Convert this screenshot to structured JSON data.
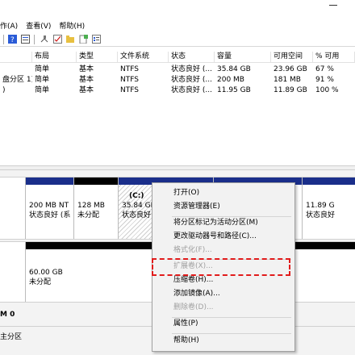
{
  "menu": [
    "作(A)",
    "查看(V)",
    "帮助(H)"
  ],
  "table": {
    "headers": [
      "布局",
      "类型",
      "文件系统",
      "状态",
      "容量",
      "可用空间",
      "% 可用"
    ],
    "rows": [
      {
        "name": "",
        "cells": [
          "简单",
          "基本",
          "NTFS",
          "状态良好 (...",
          "35.84 GB",
          "23.96 GB",
          "67 %"
        ]
      },
      {
        "name": "盘分区 1)",
        "cells": [
          "简单",
          "基本",
          "NTFS",
          "状态良好 (...",
          "200 MB",
          "181 MB",
          "91 %"
        ]
      },
      {
        "name": ")",
        "cells": [
          "简单",
          "基本",
          "NTFS",
          "状态良好 (...",
          "11.95 GB",
          "11.89 GB",
          "100 %"
        ]
      }
    ]
  },
  "disk0": {
    "partitions": [
      {
        "line1": "200 MB NT",
        "line2": "状态良好 (系"
      },
      {
        "line1": "128 MB",
        "line2": "未分配"
      },
      {
        "line0": "(C:)",
        "line1": "35.84 GE",
        "line2": "状态良好"
      },
      {
        "line1": "11.89 G",
        "line2": "状态良好"
      }
    ]
  },
  "disk1": {
    "partition": {
      "line1": "60.00 GB",
      "line2": "未分配"
    }
  },
  "bottom": {
    "disk_label": "M 0",
    "legend": "主分区"
  },
  "context_menu": {
    "items": [
      {
        "label": "打开(O)",
        "disabled": false
      },
      {
        "label": "资源管理器(E)",
        "disabled": false
      },
      {
        "label": "将分区标记为活动分区(M)",
        "disabled": false
      },
      {
        "label": "更改驱动器号和路径(C)...",
        "disabled": false
      },
      {
        "label": "格式化(F)...",
        "disabled": true
      },
      {
        "label": "扩展卷(X)...",
        "disabled": true
      },
      {
        "label": "压缩卷(H)...",
        "disabled": false
      },
      {
        "label": "添加镜像(A)...",
        "disabled": false
      },
      {
        "label": "删除卷(D)...",
        "disabled": true
      },
      {
        "label": "属性(P)",
        "disabled": false
      },
      {
        "label": "帮助(H)",
        "disabled": false
      }
    ]
  },
  "colors": {
    "primary_partition": "#1a2e8a",
    "unallocated": "#000000",
    "highlight": "#e11b1b"
  }
}
